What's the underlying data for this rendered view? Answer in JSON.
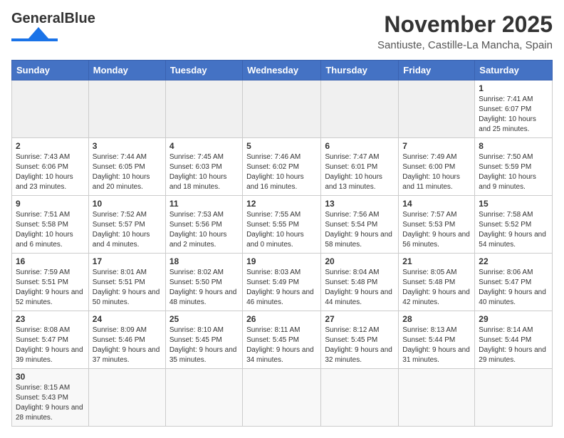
{
  "header": {
    "logo_text_general": "General",
    "logo_text_blue": "Blue",
    "month_title": "November 2025",
    "location": "Santiuste, Castille-La Mancha, Spain"
  },
  "weekdays": [
    "Sunday",
    "Monday",
    "Tuesday",
    "Wednesday",
    "Thursday",
    "Friday",
    "Saturday"
  ],
  "weeks": [
    [
      {
        "day": "",
        "info": ""
      },
      {
        "day": "",
        "info": ""
      },
      {
        "day": "",
        "info": ""
      },
      {
        "day": "",
        "info": ""
      },
      {
        "day": "",
        "info": ""
      },
      {
        "day": "",
        "info": ""
      },
      {
        "day": "1",
        "info": "Sunrise: 7:41 AM\nSunset: 6:07 PM\nDaylight: 10 hours\nand 25 minutes."
      }
    ],
    [
      {
        "day": "2",
        "info": "Sunrise: 7:43 AM\nSunset: 6:06 PM\nDaylight: 10 hours\nand 23 minutes."
      },
      {
        "day": "3",
        "info": "Sunrise: 7:44 AM\nSunset: 6:05 PM\nDaylight: 10 hours\nand 20 minutes."
      },
      {
        "day": "4",
        "info": "Sunrise: 7:45 AM\nSunset: 6:03 PM\nDaylight: 10 hours\nand 18 minutes."
      },
      {
        "day": "5",
        "info": "Sunrise: 7:46 AM\nSunset: 6:02 PM\nDaylight: 10 hours\nand 16 minutes."
      },
      {
        "day": "6",
        "info": "Sunrise: 7:47 AM\nSunset: 6:01 PM\nDaylight: 10 hours\nand 13 minutes."
      },
      {
        "day": "7",
        "info": "Sunrise: 7:49 AM\nSunset: 6:00 PM\nDaylight: 10 hours\nand 11 minutes."
      },
      {
        "day": "8",
        "info": "Sunrise: 7:50 AM\nSunset: 5:59 PM\nDaylight: 10 hours\nand 9 minutes."
      }
    ],
    [
      {
        "day": "9",
        "info": "Sunrise: 7:51 AM\nSunset: 5:58 PM\nDaylight: 10 hours\nand 6 minutes."
      },
      {
        "day": "10",
        "info": "Sunrise: 7:52 AM\nSunset: 5:57 PM\nDaylight: 10 hours\nand 4 minutes."
      },
      {
        "day": "11",
        "info": "Sunrise: 7:53 AM\nSunset: 5:56 PM\nDaylight: 10 hours\nand 2 minutes."
      },
      {
        "day": "12",
        "info": "Sunrise: 7:55 AM\nSunset: 5:55 PM\nDaylight: 10 hours\nand 0 minutes."
      },
      {
        "day": "13",
        "info": "Sunrise: 7:56 AM\nSunset: 5:54 PM\nDaylight: 9 hours\nand 58 minutes."
      },
      {
        "day": "14",
        "info": "Sunrise: 7:57 AM\nSunset: 5:53 PM\nDaylight: 9 hours\nand 56 minutes."
      },
      {
        "day": "15",
        "info": "Sunrise: 7:58 AM\nSunset: 5:52 PM\nDaylight: 9 hours\nand 54 minutes."
      }
    ],
    [
      {
        "day": "16",
        "info": "Sunrise: 7:59 AM\nSunset: 5:51 PM\nDaylight: 9 hours\nand 52 minutes."
      },
      {
        "day": "17",
        "info": "Sunrise: 8:01 AM\nSunset: 5:51 PM\nDaylight: 9 hours\nand 50 minutes."
      },
      {
        "day": "18",
        "info": "Sunrise: 8:02 AM\nSunset: 5:50 PM\nDaylight: 9 hours\nand 48 minutes."
      },
      {
        "day": "19",
        "info": "Sunrise: 8:03 AM\nSunset: 5:49 PM\nDaylight: 9 hours\nand 46 minutes."
      },
      {
        "day": "20",
        "info": "Sunrise: 8:04 AM\nSunset: 5:48 PM\nDaylight: 9 hours\nand 44 minutes."
      },
      {
        "day": "21",
        "info": "Sunrise: 8:05 AM\nSunset: 5:48 PM\nDaylight: 9 hours\nand 42 minutes."
      },
      {
        "day": "22",
        "info": "Sunrise: 8:06 AM\nSunset: 5:47 PM\nDaylight: 9 hours\nand 40 minutes."
      }
    ],
    [
      {
        "day": "23",
        "info": "Sunrise: 8:08 AM\nSunset: 5:47 PM\nDaylight: 9 hours\nand 39 minutes."
      },
      {
        "day": "24",
        "info": "Sunrise: 8:09 AM\nSunset: 5:46 PM\nDaylight: 9 hours\nand 37 minutes."
      },
      {
        "day": "25",
        "info": "Sunrise: 8:10 AM\nSunset: 5:45 PM\nDaylight: 9 hours\nand 35 minutes."
      },
      {
        "day": "26",
        "info": "Sunrise: 8:11 AM\nSunset: 5:45 PM\nDaylight: 9 hours\nand 34 minutes."
      },
      {
        "day": "27",
        "info": "Sunrise: 8:12 AM\nSunset: 5:45 PM\nDaylight: 9 hours\nand 32 minutes."
      },
      {
        "day": "28",
        "info": "Sunrise: 8:13 AM\nSunset: 5:44 PM\nDaylight: 9 hours\nand 31 minutes."
      },
      {
        "day": "29",
        "info": "Sunrise: 8:14 AM\nSunset: 5:44 PM\nDaylight: 9 hours\nand 29 minutes."
      }
    ],
    [
      {
        "day": "30",
        "info": "Sunrise: 8:15 AM\nSunset: 5:43 PM\nDaylight: 9 hours\nand 28 minutes."
      },
      {
        "day": "",
        "info": ""
      },
      {
        "day": "",
        "info": ""
      },
      {
        "day": "",
        "info": ""
      },
      {
        "day": "",
        "info": ""
      },
      {
        "day": "",
        "info": ""
      },
      {
        "day": "",
        "info": ""
      }
    ]
  ]
}
